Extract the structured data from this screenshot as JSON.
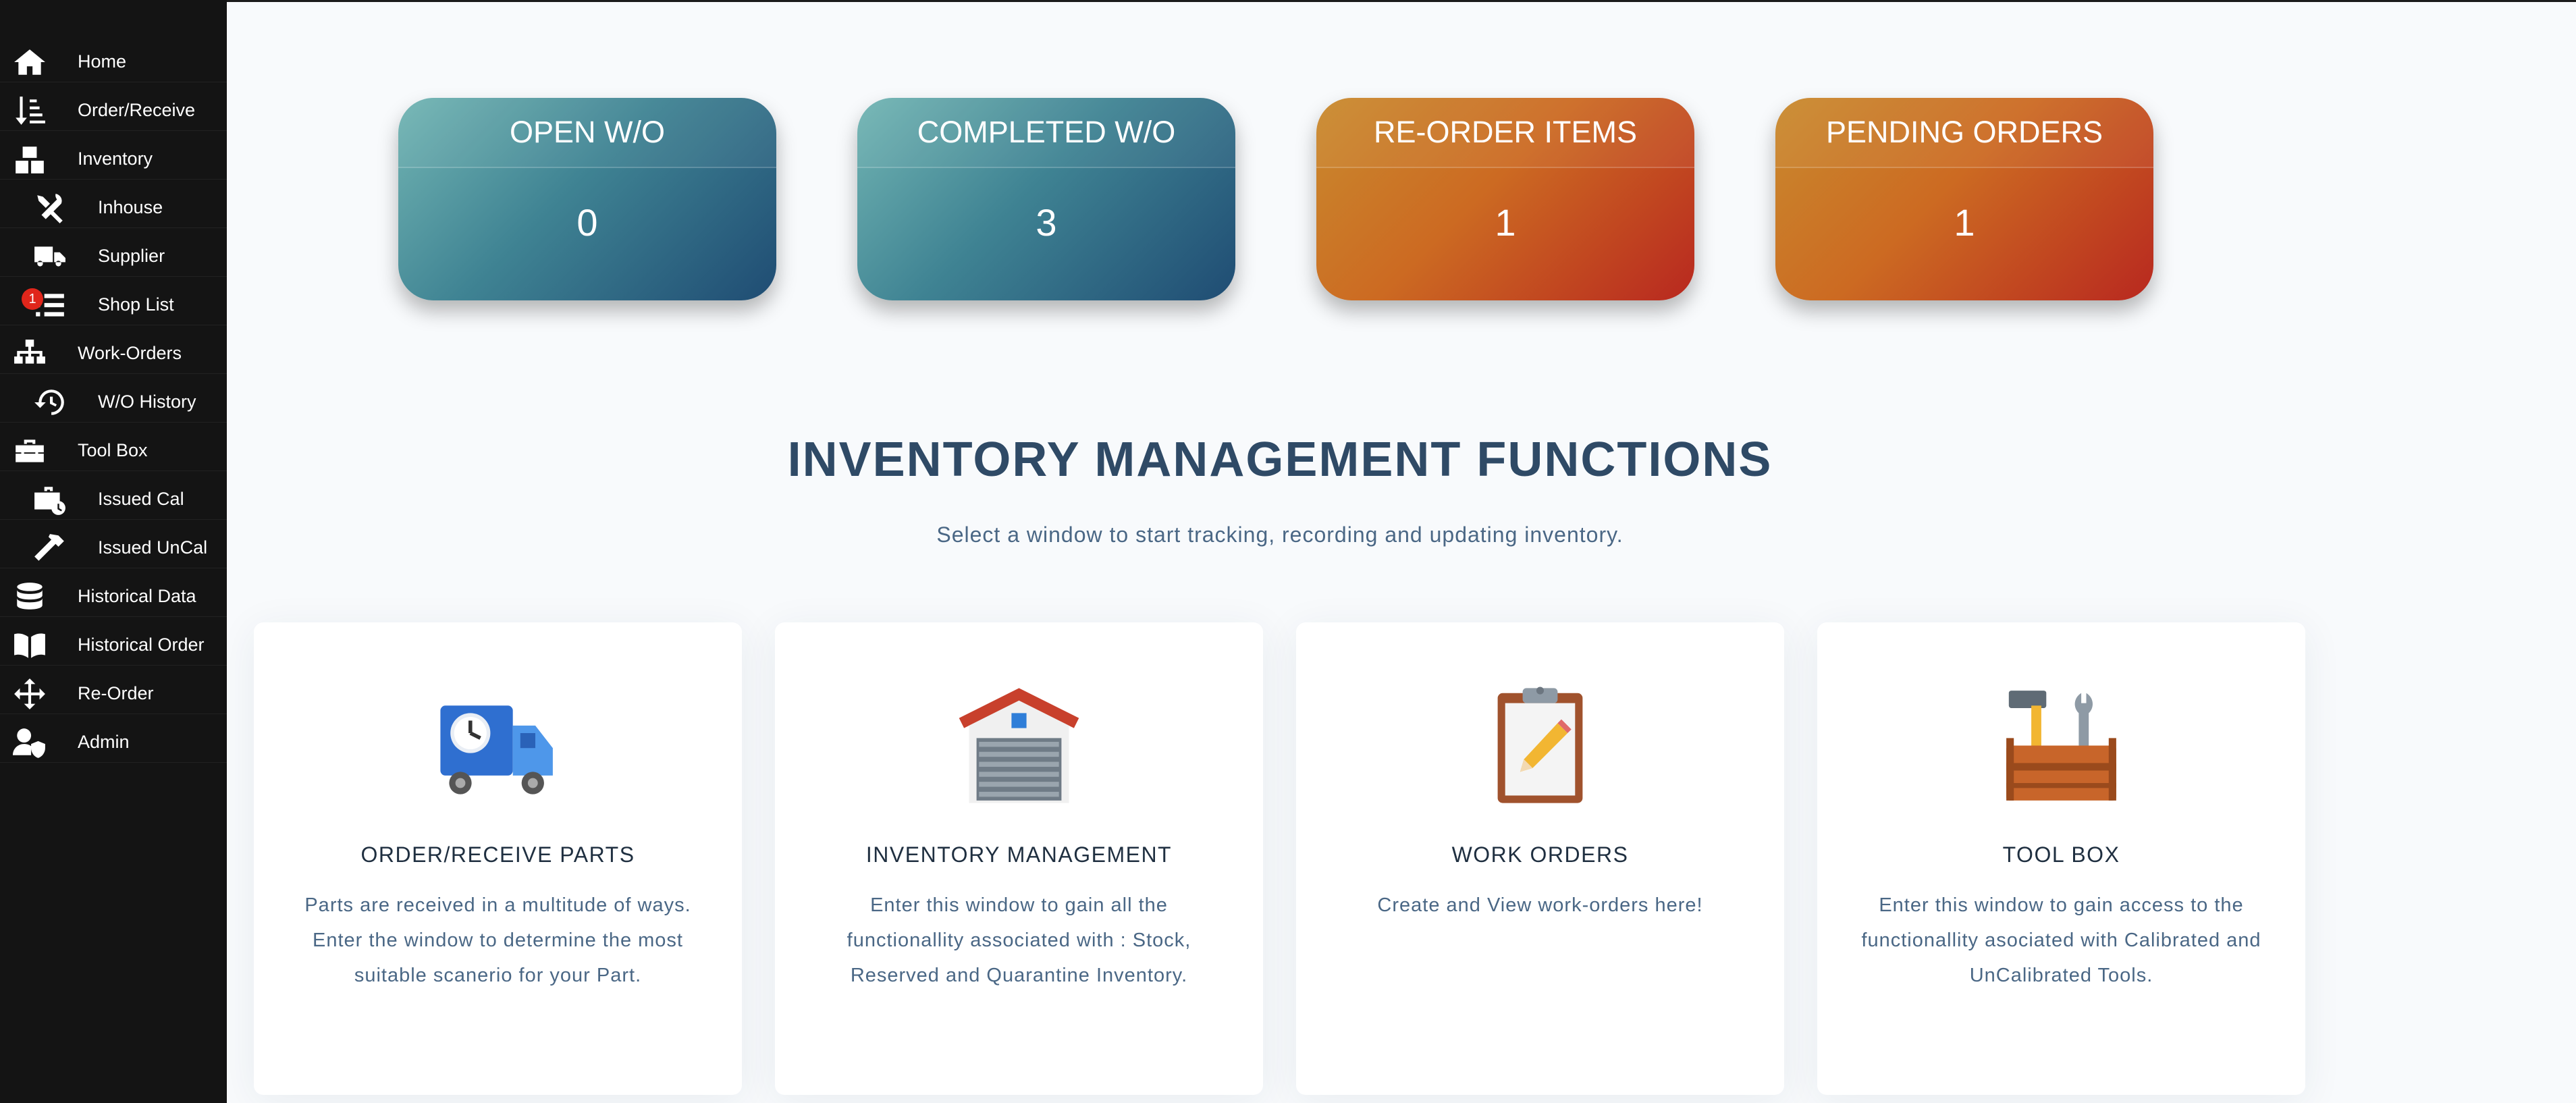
{
  "sidebar": {
    "items": [
      {
        "label": "Home",
        "icon": "home-icon"
      },
      {
        "label": "Order/Receive",
        "icon": "sort-list-icon"
      },
      {
        "label": "Inventory",
        "icon": "boxes-icon"
      },
      {
        "label": "Inhouse",
        "icon": "tools-icon"
      },
      {
        "label": "Supplier",
        "icon": "truck-icon"
      },
      {
        "label": "Shop List",
        "icon": "list-icon",
        "badge": "1"
      },
      {
        "label": "Work-Orders",
        "icon": "sitemap-icon"
      },
      {
        "label": "W/O History",
        "icon": "history-icon"
      },
      {
        "label": "Tool Box",
        "icon": "toolbox-icon"
      },
      {
        "label": "Issued Cal",
        "icon": "briefcase-clock-icon"
      },
      {
        "label": "Issued UnCal",
        "icon": "hammer-icon"
      },
      {
        "label": "Historical Data",
        "icon": "database-icon"
      },
      {
        "label": "Historical Order",
        "icon": "book-open-icon"
      },
      {
        "label": "Re-Order",
        "icon": "arrows-move-icon"
      },
      {
        "label": "Admin",
        "icon": "user-shield-icon"
      }
    ]
  },
  "stats": [
    {
      "label": "OPEN W/O",
      "value": "0",
      "color": "#2f6d85"
    },
    {
      "label": "COMPLETED W/O",
      "value": "3",
      "color": "#2f6d85"
    },
    {
      "label": "RE-ORDER ITEMS",
      "value": "1",
      "color": "#c9521f"
    },
    {
      "label": "PENDING ORDERS",
      "value": "1",
      "color": "#c9521f"
    }
  ],
  "section": {
    "title": "INVENTORY MANAGEMENT FUNCTIONS",
    "subtitle": "Select a window to start tracking, recording and updating inventory."
  },
  "functions": [
    {
      "title": "ORDER/RECEIVE PARTS",
      "icon": "delivery-truck-clock-icon",
      "description": "Parts are received in a multitude of ways. Enter the window to determine the most suitable scanerio for your Part."
    },
    {
      "title": "INVENTORY MANAGEMENT",
      "icon": "warehouse-icon",
      "description": "Enter this window to gain all the functionallity associated with : Stock, Reserved and Quarantine Inventory."
    },
    {
      "title": "WORK ORDERS",
      "icon": "clipboard-pencil-icon",
      "description": "Create and View work-orders here!"
    },
    {
      "title": "TOOL BOX",
      "icon": "toolbox-hammer-wrench-icon",
      "description": "Enter this window to gain access to the functionallity asociated with Calibrated and UnCalibrated Tools."
    }
  ]
}
